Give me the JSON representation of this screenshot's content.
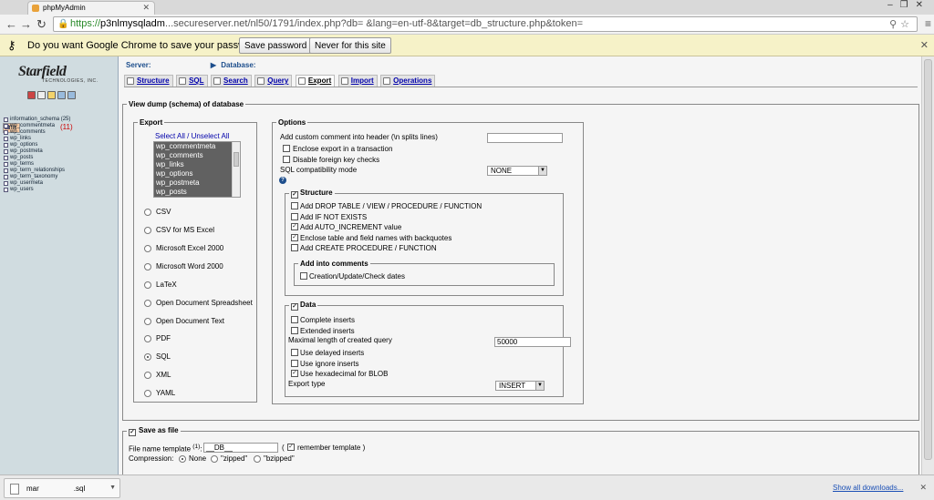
{
  "browser": {
    "tab_title": "phpMyAdmin",
    "url_https": "https://",
    "url_host": "p3nlmysqladm",
    "url_rest": "...secureserver.net/nl50/1791/index.php?db=                    &lang=en-utf-8&target=db_structure.php&token=",
    "infobar_message": "Do you want Google Chrome to save your password?",
    "save_password_label": "Save password",
    "never_label": "Never for this site"
  },
  "left": {
    "logo_text": "Starfield",
    "logo_sub": "TECHNOLOGIES, INC.",
    "databases": [
      {
        "name": "information_schema (25)"
      },
      {
        "name": "ma",
        "count": "(11)"
      },
      {
        "name": "wp_commentmeta"
      },
      {
        "name": "wp_comments"
      },
      {
        "name": "wp_links"
      },
      {
        "name": "wp_options"
      },
      {
        "name": "wp_postmeta"
      },
      {
        "name": "wp_posts"
      },
      {
        "name": "wp_terms"
      },
      {
        "name": "wp_term_relationships"
      },
      {
        "name": "wp_term_taxonomy"
      },
      {
        "name": "wp_usermeta"
      },
      {
        "name": "wp_users"
      }
    ]
  },
  "main": {
    "server_label": "Server:",
    "database_label": "Database:",
    "tabs": [
      {
        "label": "Structure"
      },
      {
        "label": "SQL"
      },
      {
        "label": "Search"
      },
      {
        "label": "Query"
      },
      {
        "label": "Export"
      },
      {
        "label": "Import"
      },
      {
        "label": "Operations"
      }
    ],
    "dump_legend": "View dump (schema) of database",
    "export": {
      "legend": "Export",
      "select_all": "Select All / Unselect All",
      "tables": [
        "wp_commentmeta",
        "wp_comments",
        "wp_links",
        "wp_options",
        "wp_postmeta",
        "wp_posts"
      ],
      "formats": [
        {
          "label": "CSV",
          "checked": false
        },
        {
          "label": "CSV for MS Excel",
          "checked": false
        },
        {
          "label": "Microsoft Excel 2000",
          "checked": false
        },
        {
          "label": "Microsoft Word 2000",
          "checked": false
        },
        {
          "label": "LaTeX",
          "checked": false
        },
        {
          "label": "Open Document Spreadsheet",
          "checked": false
        },
        {
          "label": "Open Document Text",
          "checked": false
        },
        {
          "label": "PDF",
          "checked": false
        },
        {
          "label": "SQL",
          "checked": true
        },
        {
          "label": "XML",
          "checked": false
        },
        {
          "label": "YAML",
          "checked": false
        }
      ]
    },
    "options": {
      "legend": "Options",
      "custom_comment": "Add custom comment into header (\\n splits lines)",
      "enclose_transaction": "Enclose export in a transaction",
      "disable_fk": "Disable foreign key checks",
      "sql_compat": "SQL compatibility mode",
      "sql_compat_value": "NONE",
      "structure_legend": "Structure",
      "structure_items": [
        {
          "label": "Add DROP TABLE / VIEW / PROCEDURE / FUNCTION",
          "checked": false
        },
        {
          "label": "Add IF NOT EXISTS",
          "checked": false
        },
        {
          "label": "Add AUTO_INCREMENT value",
          "checked": true
        },
        {
          "label": "Enclose table and field names with backquotes",
          "checked": true
        },
        {
          "label": "Add CREATE PROCEDURE / FUNCTION",
          "checked": false
        }
      ],
      "comments_legend": "Add into comments",
      "comments_item": "Creation/Update/Check dates",
      "data_legend": "Data",
      "complete_inserts": "Complete inserts",
      "extended_inserts": "Extended inserts",
      "max_length_label": "Maximal length of created query",
      "max_length_value": "50000",
      "delayed_inserts": "Use delayed inserts",
      "ignore_inserts": "Use ignore inserts",
      "hex_blob": "Use hexadecimal for BLOB",
      "export_type_label": "Export type",
      "export_type_value": "INSERT"
    },
    "save": {
      "legend": "Save as file",
      "file_template_label": "File name template",
      "file_template_sup": "(1)",
      "file_template_value": "__DB__",
      "remember_open": "(",
      "remember_label": "remember template )",
      "compression_label": "Compression:",
      "compression": [
        {
          "label": "None",
          "checked": true
        },
        {
          "label": "\"zipped\"",
          "checked": false
        },
        {
          "label": "\"bzipped\"",
          "checked": false
        }
      ]
    }
  },
  "downloads": {
    "file_name_start": "mar",
    "file_ext": ".sql",
    "show_all": "Show all downloads..."
  }
}
